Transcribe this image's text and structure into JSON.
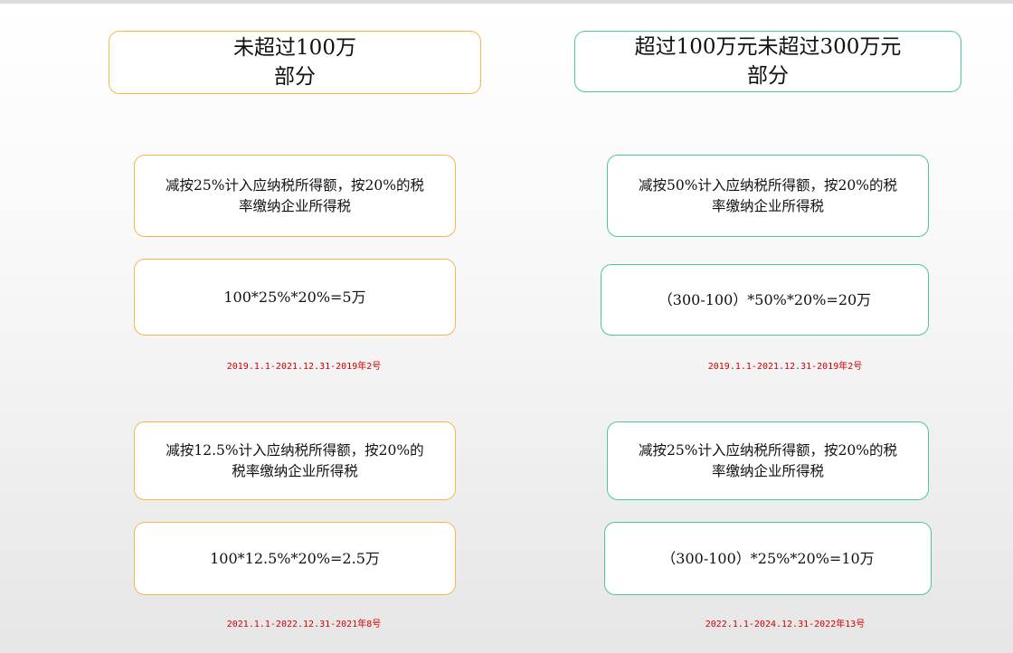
{
  "columns": {
    "left": {
      "header": "未超过100万\n部分",
      "accent_color": "#f7b54a",
      "periods": [
        {
          "description": "减按25%计入应纳税所得额，按20%的税\n率缴纳企业所得税",
          "formula": "100*25%*20%=5万",
          "reference": "2019.1.1-2021.12.31-2019年2号"
        },
        {
          "description": "减按12.5%计入应纳税所得额，按20%的\n税率缴纳企业所得税",
          "formula": "100*12.5%*20%=2.5万",
          "reference": "2021.1.1-2022.12.31-2021年8号"
        }
      ]
    },
    "right": {
      "header": "超过100万元未超过300万元\n部分",
      "accent_color": "#4fc69a",
      "periods": [
        {
          "description": "减按50%计入应纳税所得额，按20%的税\n率缴纳企业所得税",
          "formula": "（300-100）*50%*20%=20万",
          "reference": "2019.1.1-2021.12.31-2019年2号"
        },
        {
          "description": "减按25%计入应纳税所得额，按20%的税\n率缴纳企业所得税",
          "formula": "（300-100）*25%*20%=10万",
          "reference": "2022.1.1-2024.12.31-2022年13号"
        }
      ]
    }
  },
  "reference_color": "#d40000"
}
